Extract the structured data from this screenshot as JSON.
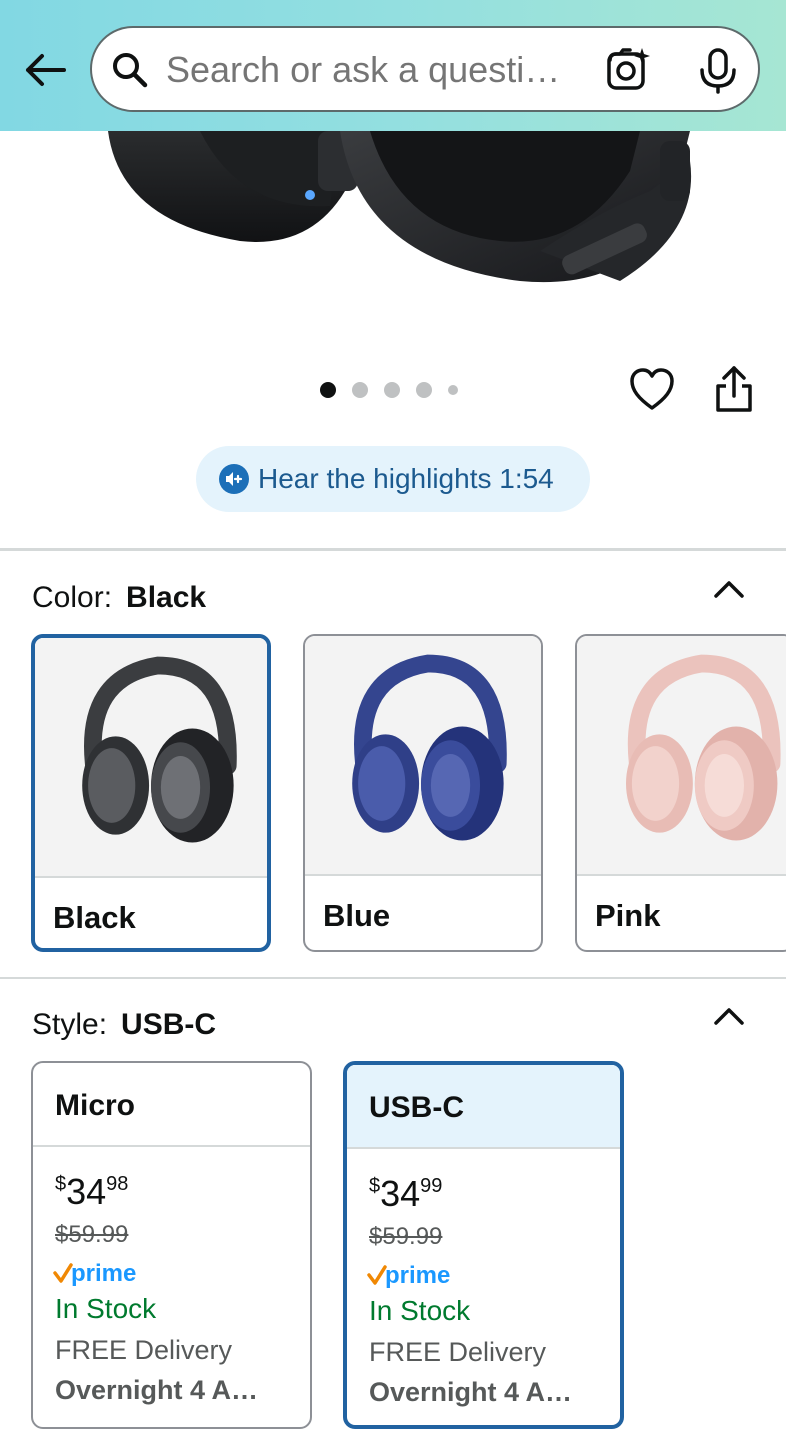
{
  "header": {
    "search_placeholder": "Search or ask a questi…",
    "back_icon": "arrow-left-icon",
    "search_icon": "magnifier-icon",
    "lens_icon": "camera-lens-icon",
    "mic_icon": "microphone-icon"
  },
  "gallery": {
    "dot_count": 5,
    "active_index": 0
  },
  "highlights": {
    "label": "Hear the highlights 1:54",
    "icon": "audio-play-icon"
  },
  "color": {
    "label": "Color:",
    "selected": "Black",
    "options": [
      {
        "name": "Black",
        "color": "#4a4c4e"
      },
      {
        "name": "Blue",
        "color": "#3e4f9a"
      },
      {
        "name": "Pink",
        "color": "#efc8c2"
      }
    ]
  },
  "style": {
    "label": "Style:",
    "selected": "USB-C",
    "options": [
      {
        "name": "Micro",
        "price_symbol": "$",
        "price_whole": "34",
        "price_fraction": "98",
        "list_price": "$59.99",
        "prime": "prime",
        "stock": "In Stock",
        "delivery": "FREE Delivery",
        "delivery_date": "Overnight 4 A…"
      },
      {
        "name": "USB-C",
        "price_symbol": "$",
        "price_whole": "34",
        "price_fraction": "99",
        "list_price": "$59.99",
        "prime": "prime",
        "stock": "In Stock",
        "delivery": "FREE Delivery",
        "delivery_date": "Overnight 4 A…"
      }
    ]
  },
  "colors": {
    "accent": "#2162a1",
    "stock_green": "#007a2e",
    "prime_blue": "#1a98ff",
    "prime_check": "#f08804"
  }
}
